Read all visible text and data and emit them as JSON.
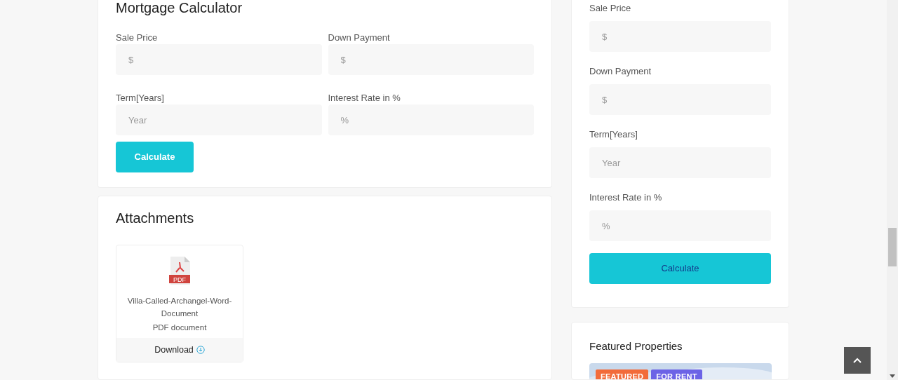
{
  "mortgage_calculator": {
    "title": "Mortgage Calculator",
    "fields": [
      {
        "label": "Sale Price",
        "placeholder": "$"
      },
      {
        "label": "Down Payment",
        "placeholder": "$"
      },
      {
        "label": "Term[Years]",
        "placeholder": "Year"
      },
      {
        "label": "Interest Rate in %",
        "placeholder": "%"
      }
    ],
    "button": "Calculate"
  },
  "attachments": {
    "title": "Attachments",
    "files": [
      {
        "name": "Villa-Called-Archangel-Word-Document",
        "type": "PDF document",
        "icon_label": "PDF",
        "action": "Download"
      }
    ]
  },
  "sidebar_calculator": {
    "fields": [
      {
        "label": "Sale Price",
        "placeholder": "$"
      },
      {
        "label": "Down Payment",
        "placeholder": "$"
      },
      {
        "label": "Term[Years]",
        "placeholder": "Year"
      },
      {
        "label": "Interest Rate in %",
        "placeholder": "%"
      }
    ],
    "button": "Calculate"
  },
  "featured_properties": {
    "title": "Featured Properties",
    "cards": [
      {
        "kind": "picture",
        "badges": [
          {
            "label": "FEATURED",
            "color": "#f26b3a"
          },
          {
            "label": "FOR RENT",
            "color": "#6c63e6"
          }
        ]
      }
    ]
  }
}
